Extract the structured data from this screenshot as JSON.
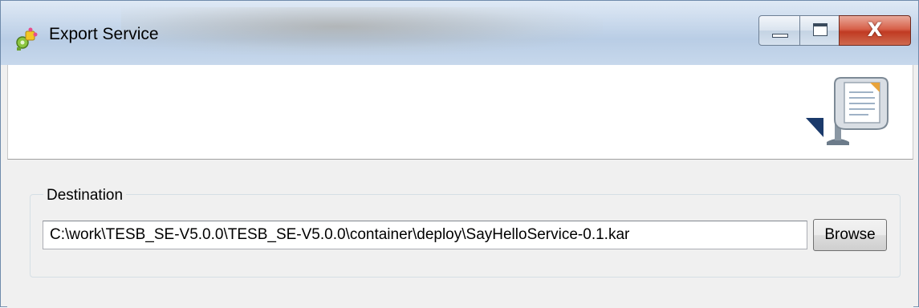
{
  "window": {
    "title": "Export Service",
    "app_icon": "puzzle-gear-icon",
    "controls": {
      "minimize_icon": "minimize-icon",
      "maximize_icon": "maximize-icon",
      "close_label": "X"
    }
  },
  "banner": {
    "icon": "export-wizard-icon"
  },
  "destination": {
    "group_label": "Destination",
    "path_value": "C:\\work\\TESB_SE-V5.0.0\\TESB_SE-V5.0.0\\container\\deploy\\SayHelloService-0.1.kar",
    "browse_label": "Browse"
  },
  "colors": {
    "titlebar": "#c9d9ec",
    "close_button": "#c03a22",
    "panel_background": "#f0f0f0"
  }
}
